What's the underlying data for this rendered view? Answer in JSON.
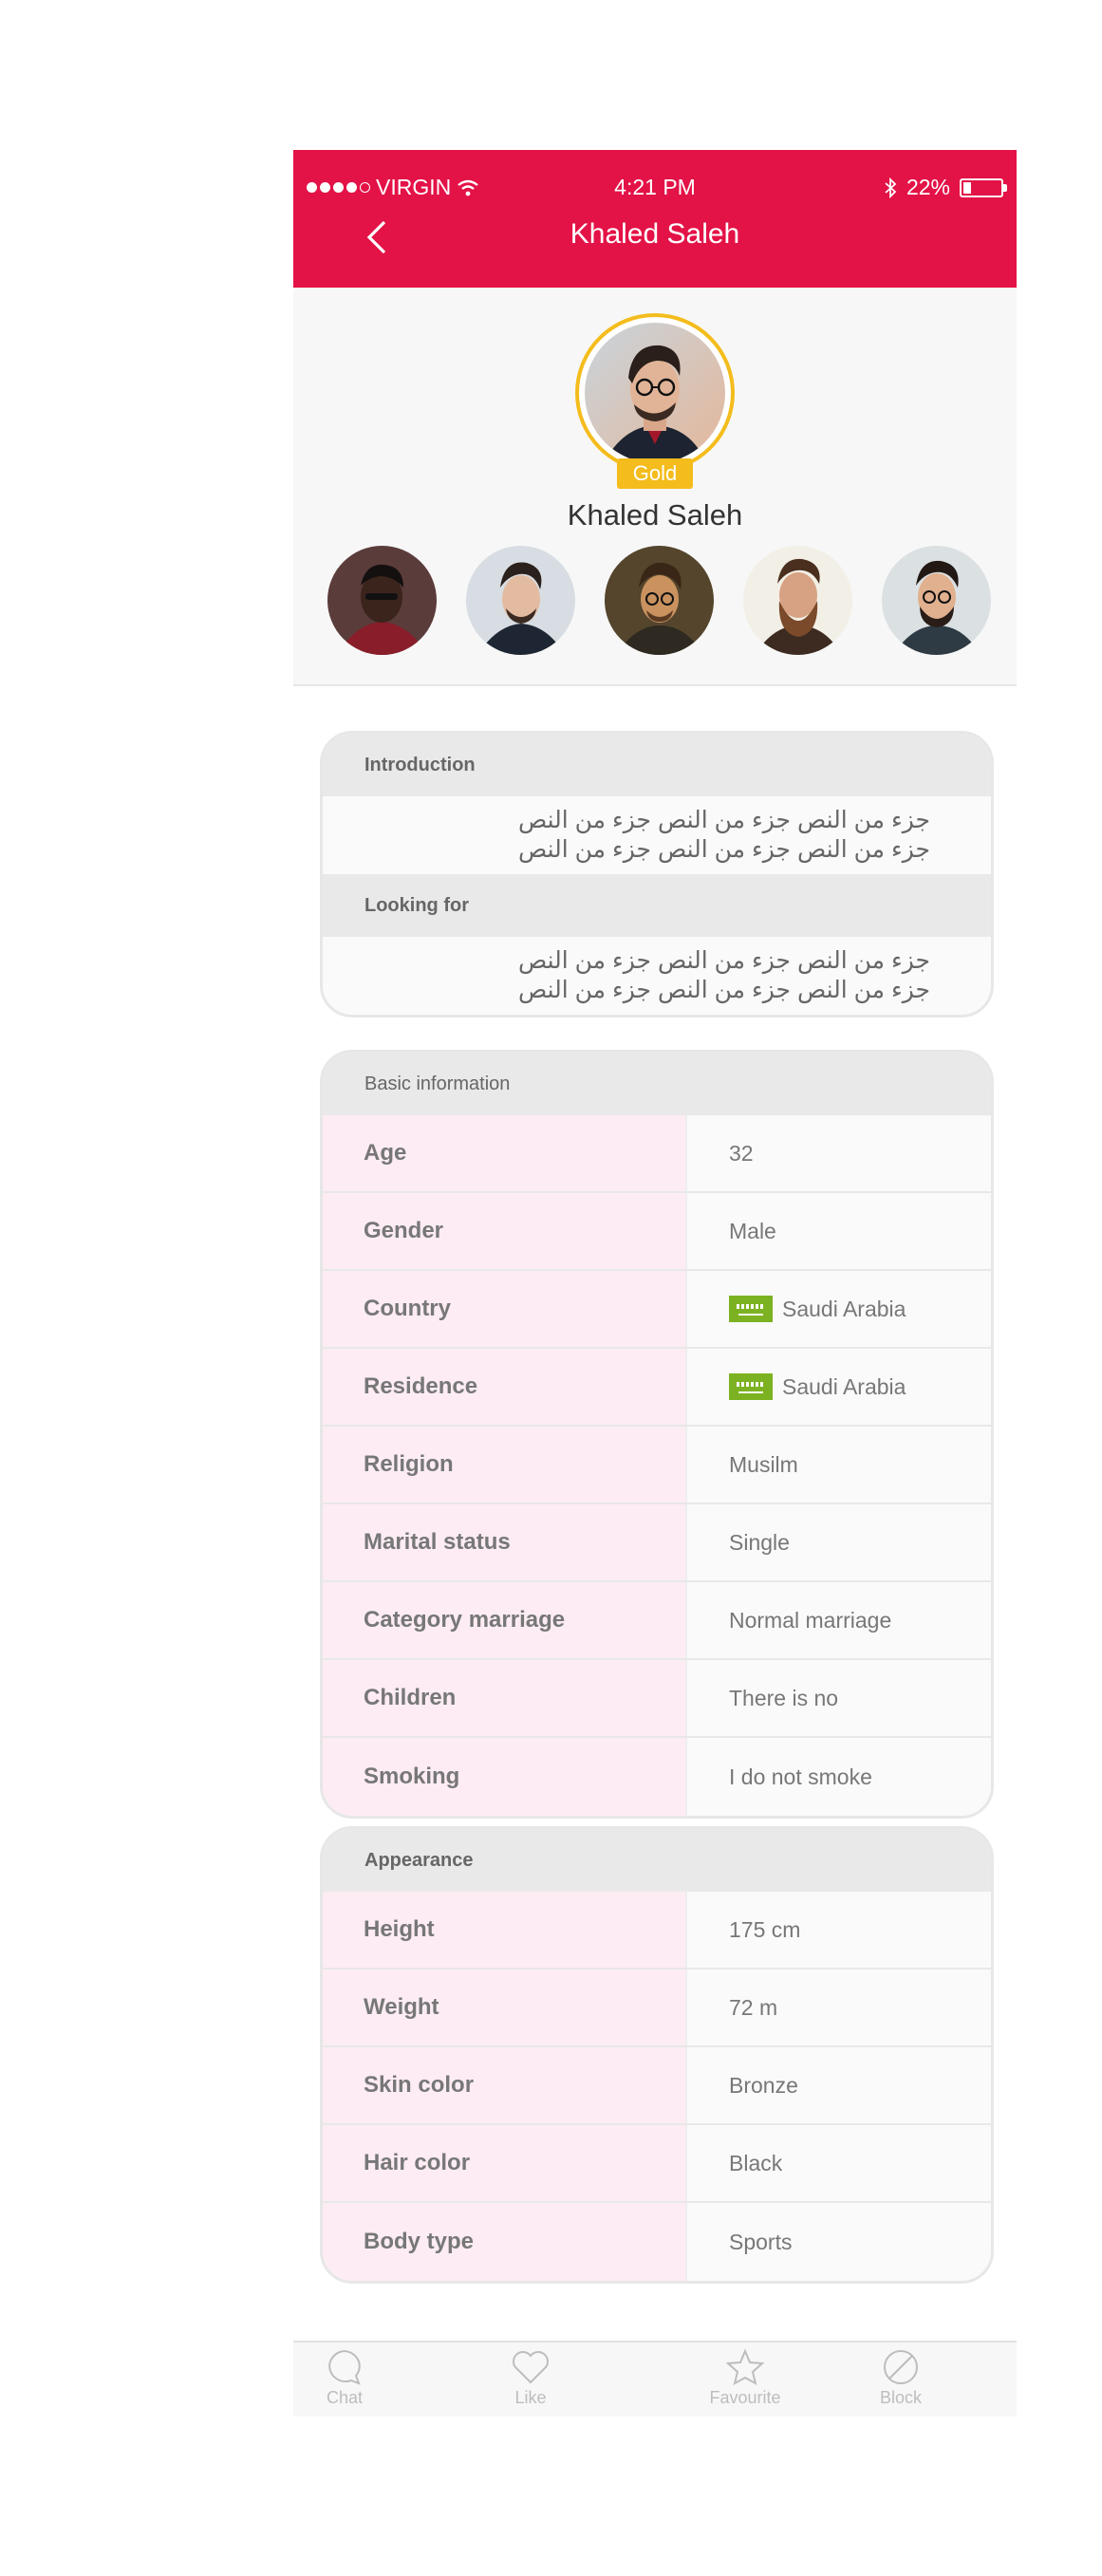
{
  "status_bar": {
    "carrier": "VIRGIN",
    "time": "4:21 PM",
    "battery": "22%",
    "battery_level": 0.22
  },
  "nav": {
    "title": "Khaled Saleh"
  },
  "profile": {
    "badge": "Gold",
    "name": "Khaled Saleh",
    "accent_color": "#e31247",
    "gold_color": "#f4bc1c"
  },
  "about": {
    "introduction_title": "Introduction",
    "introduction_line1": "جزء من النص جزء من النص جزء من النص",
    "introduction_line2": "جزء من النص جزء من النص جزء من النص",
    "looking_title": "Looking for",
    "looking_line1": "جزء من النص جزء من النص جزء من النص",
    "looking_line2": "جزء من النص جزء من النص جزء من النص"
  },
  "basic": {
    "title": "Basic information",
    "rows": [
      {
        "label": "Age",
        "value": "32"
      },
      {
        "label": "Gender",
        "value": "Male"
      },
      {
        "label": "Country",
        "value": "Saudi Arabia",
        "flag": "saudi-flag"
      },
      {
        "label": "Residence",
        "value": "Saudi Arabia",
        "flag": "saudi-flag"
      },
      {
        "label": "Religion",
        "value": "Musilm"
      },
      {
        "label": "Marital status",
        "value": "Single"
      },
      {
        "label": "Category marriage",
        "value": "Normal marriage"
      },
      {
        "label": "Children",
        "value": "There is no"
      },
      {
        "label": "Smoking",
        "value": "I do not smoke"
      }
    ]
  },
  "appearance": {
    "title": "Appearance",
    "rows": [
      {
        "label": "Height",
        "value": "175 cm"
      },
      {
        "label": "Weight",
        "value": "72 m"
      },
      {
        "label": "Skin color",
        "value": "Bronze"
      },
      {
        "label": "Hair color",
        "value": "Black"
      },
      {
        "label": "Body type",
        "value": "Sports"
      }
    ]
  },
  "tabs": {
    "chat": "Chat",
    "like": "Like",
    "favourite": "Favourite",
    "block": "Block"
  }
}
